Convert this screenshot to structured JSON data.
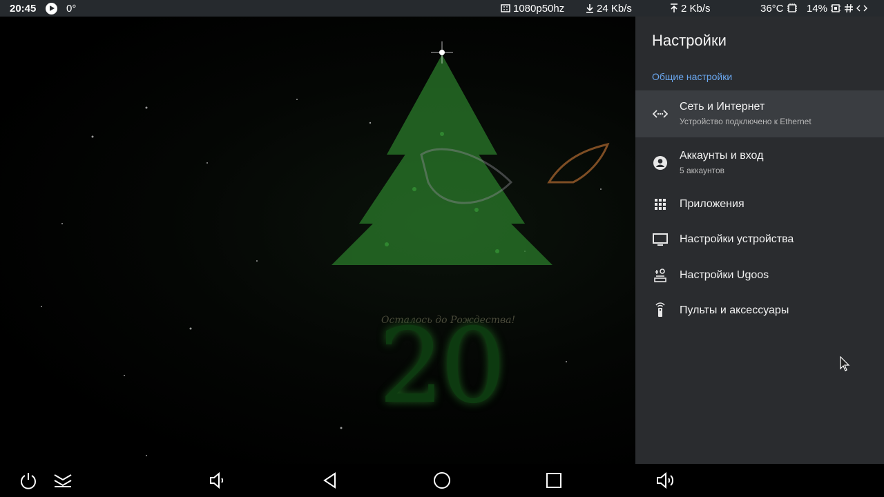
{
  "status_bar": {
    "time": "20:45",
    "play_icon": "play-circle-icon",
    "degree": "0°",
    "resolution": "1080p50hz",
    "download": "24 Kb/s",
    "upload": "2 Kb/s",
    "temperature": "36°C",
    "battery": "14%"
  },
  "wallpaper": {
    "caption": "Осталось до Рождества!",
    "countdown": "20"
  },
  "settings": {
    "title": "Настройки",
    "section": "Общие настройки",
    "items": [
      {
        "label": "Сеть и Интернет",
        "subtitle": "Устройство подключено к Ethernet",
        "icon": "network-icon"
      },
      {
        "label": "Аккаунты и вход",
        "subtitle": "5 аккаунтов",
        "icon": "account-icon"
      },
      {
        "label": "Приложения",
        "subtitle": "",
        "icon": "apps-grid-icon"
      },
      {
        "label": "Настройки устройства",
        "subtitle": "",
        "icon": "tv-icon"
      },
      {
        "label": "Настройки Ugoos",
        "subtitle": "",
        "icon": "ugoos-settings-icon"
      },
      {
        "label": "Пульты и аксессуары",
        "subtitle": "",
        "icon": "remote-icon"
      }
    ]
  },
  "colors": {
    "panel_bg": "#2a2c2f",
    "selected_bg": "#3a3d41",
    "accent": "#6aa7ef",
    "statusbar_bg": "#262a2e"
  }
}
